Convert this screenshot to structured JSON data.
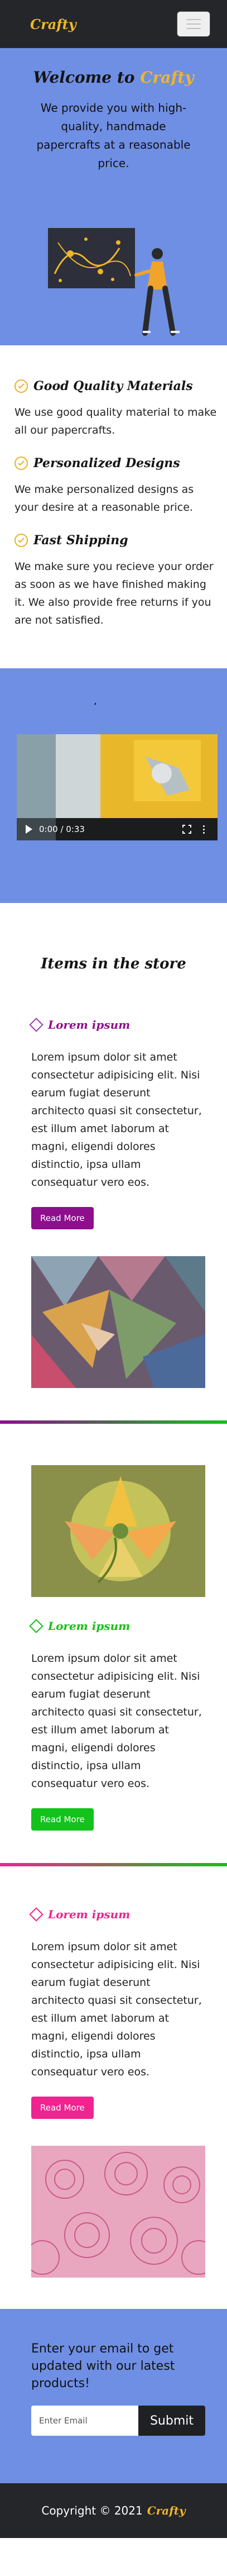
{
  "navbar": {
    "brand": "Crafty"
  },
  "hero": {
    "title_prefix": "Welcome to",
    "title_brand": "Crafty",
    "text": "We provide you with high-quality, handmade papercrafts at a reasonable price."
  },
  "features": [
    {
      "title": "Good Quality Materials",
      "text": "We use good quality material to make all our papercrafts."
    },
    {
      "title": "Personalized Designs",
      "text": "We make personalized designs as your desire at a reasonable price."
    },
    {
      "title": "Fast Shipping",
      "text": "We make sure you recieve your order as soon as we have finished making it. We also provide free returns if you are not satisfied."
    }
  ],
  "video": {
    "caption": ",",
    "time": "0:00 / 0:33"
  },
  "store": {
    "title": "Items in the store",
    "items": [
      {
        "title": "Lorem ipsum",
        "text": "Lorem ipsum dolor sit amet consectetur adipisicing elit. Nisi earum fugiat deserunt architecto quasi sit consectetur, est illum amet laborum at magni, eligendi dolores distinctio, ipsa ullam consequatur vero eos.",
        "button": "Read More",
        "color": "#8e0e8c"
      },
      {
        "title": "Lorem ipsum",
        "text": "Lorem ipsum dolor sit amet consectetur adipisicing elit. Nisi earum fugiat deserunt architecto quasi sit consectetur, est illum amet laborum at magni, eligendi dolores distinctio, ipsa ullam consequatur vero eos.",
        "button": "Read More",
        "color": "#13c21b"
      },
      {
        "title": "Lorem ipsum",
        "text": "Lorem ipsum dolor sit amet consectetur adipisicing elit. Nisi earum fugiat deserunt architecto quasi sit consectetur, est illum amet laborum at magni, eligendi dolores distinctio, ipsa ullam consequatur vero eos.",
        "button": "Read More",
        "color": "#ef2490"
      }
    ]
  },
  "newsletter": {
    "text": "Enter your email to get updated with our latest products!",
    "placeholder": "Enter Email",
    "submit": "Submit"
  },
  "footer": {
    "copyright": "Copyright © 2021",
    "brand": "Crafty"
  },
  "colors": {
    "hero_bg": "#6f8fe4",
    "nav_bg": "#242629",
    "brand": "#f0b52b"
  }
}
